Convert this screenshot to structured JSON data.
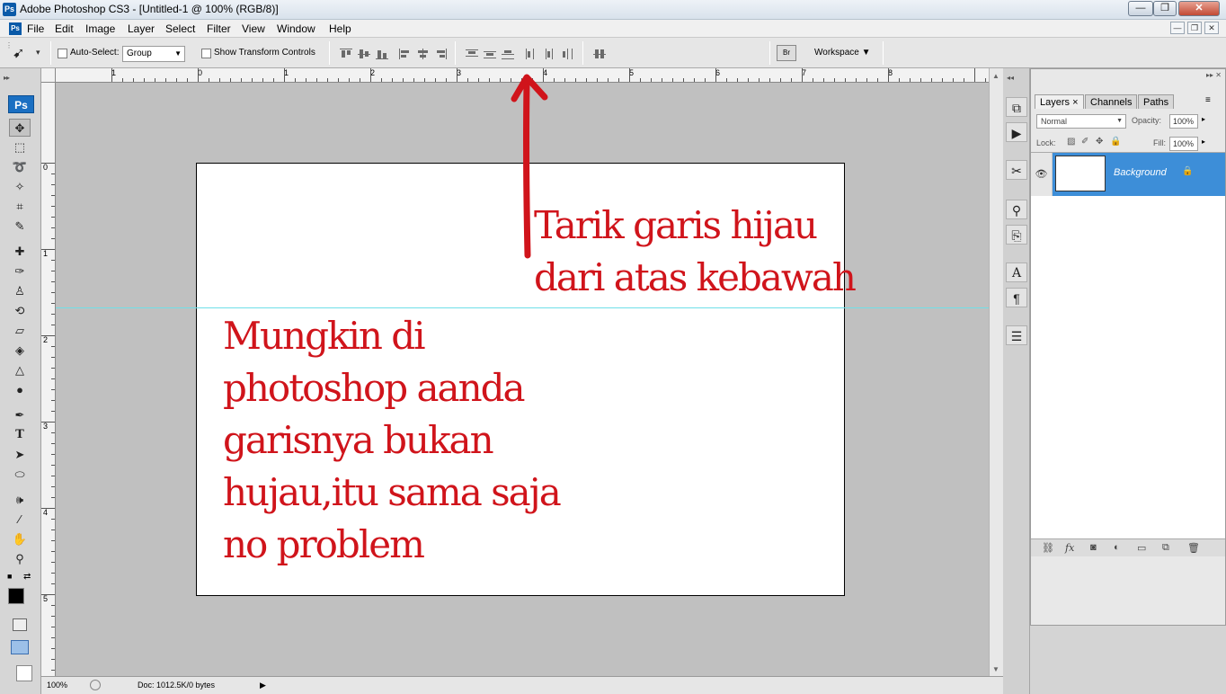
{
  "window": {
    "title": "Adobe Photoshop CS3 - [Untitled-1 @ 100% (RGB/8)]",
    "app_icon": "Ps",
    "minimize": "—",
    "restore": "❐",
    "close": "✕"
  },
  "menu": {
    "items": [
      "File",
      "Edit",
      "Image",
      "Layer",
      "Select",
      "Filter",
      "View",
      "Window",
      "Help"
    ],
    "doc_controls": [
      "—",
      "❐",
      "✕"
    ]
  },
  "options": {
    "auto_select_label": "Auto-Select:",
    "auto_select_value": "Group",
    "show_transform_label": "Show Transform Controls",
    "workspace_label": "Workspace ▼"
  },
  "toolbox": {
    "logo": "Ps",
    "tools": [
      "move",
      "marquee",
      "lasso",
      "magic-wand",
      "crop",
      "slice",
      "healing",
      "brush",
      "clone-stamp",
      "history-brush",
      "eraser",
      "paint-bucket",
      "blur",
      "dodge",
      "pen",
      "type",
      "path-select",
      "shape",
      "notes",
      "eyedropper",
      "hand",
      "zoom"
    ]
  },
  "rulers": {
    "horizontal": [
      "1",
      "0",
      "1",
      "2",
      "3",
      "4",
      "5",
      "6",
      "7",
      "8"
    ],
    "vertical": [
      "0",
      "1",
      "2",
      "3",
      "4",
      "5"
    ]
  },
  "annotation": {
    "top_line1": "Tarik garis hijau",
    "top_line2": "dari atas kebawah",
    "main_line1": "Mungkin di",
    "main_line2": "photoshop aanda",
    "main_line3": "garisnya bukan",
    "main_line4": "hujau,itu sama saja",
    "main_line5": "no problem"
  },
  "status": {
    "zoom": "100%",
    "doc": "Doc: 1012.5K/0 bytes"
  },
  "layers_panel": {
    "tabs": [
      "Layers ×",
      "Channels",
      "Paths"
    ],
    "blend_mode": "Normal",
    "opacity_label": "Opacity:",
    "opacity_value": "100%",
    "lock_label": "Lock:",
    "fill_label": "Fill:",
    "fill_value": "100%",
    "layer_name": "Background",
    "footer_icons": [
      "link-icon",
      "fx-icon",
      "mask-icon",
      "adjustment-icon",
      "group-icon",
      "new-layer-icon",
      "trash-icon"
    ]
  },
  "colors": {
    "annotation_red": "#d0141b",
    "guide_cyan": "#6fe0e8",
    "selected_layer_blue": "#3d8ed8"
  }
}
